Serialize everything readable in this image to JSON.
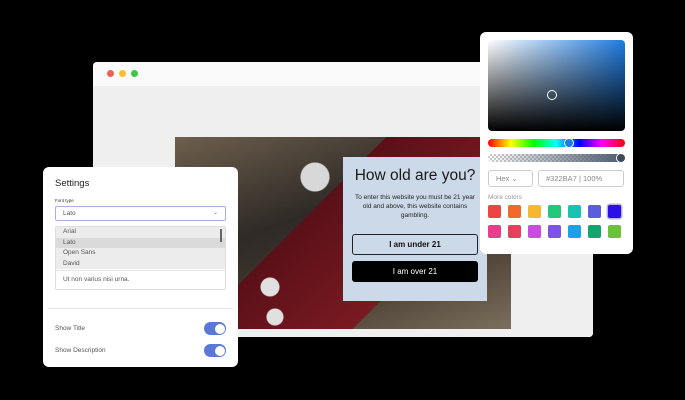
{
  "browser": {
    "dots": [
      "#f25f58",
      "#fbbe2f",
      "#3ac940"
    ]
  },
  "popup": {
    "title": "How old are you?",
    "text": "To enter this website you must be 21 year old and above, this website contains gambling.",
    "under": "I am under 21",
    "over": "I am over 21"
  },
  "settings": {
    "title": "Settings",
    "font_label": "Font type",
    "font_value": "Lato",
    "options": [
      "Arial",
      "Lato",
      "Open Sans",
      "David"
    ],
    "textarea": "Ut non varius nisi urna.",
    "show_title": "Show Title",
    "show_description": "Show Description",
    "show_title_on": true,
    "show_description_on": true
  },
  "picker": {
    "format": "Hex",
    "hex": "#322BA7",
    "opacity": "100%",
    "more_colors": "More colors",
    "swatches": [
      "#ee4444",
      "#f26a2a",
      "#f7b731",
      "#22c77a",
      "#17c2b0",
      "#5a5de0",
      "#2a10e6",
      "#e83e8c",
      "#e8405a",
      "#c94ce0",
      "#7c55e6",
      "#1ea0e6",
      "#12a56e",
      "#6cc03a"
    ],
    "selected": "#2a10e6"
  }
}
